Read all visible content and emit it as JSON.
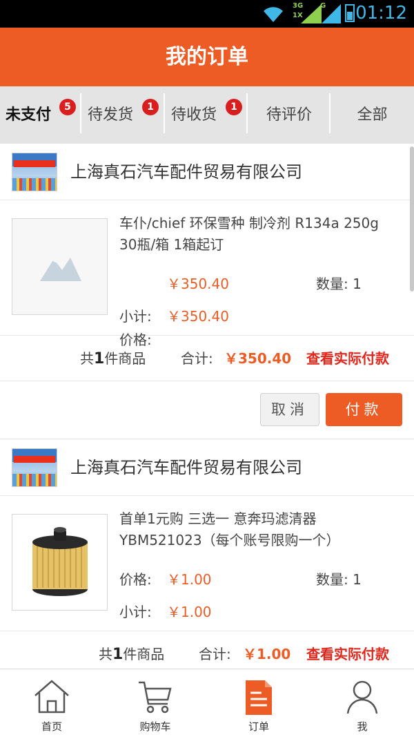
{
  "status_bar": {
    "time": "01:12",
    "net1_top": "3G",
    "net1_bottom": "1X",
    "net2": "G"
  },
  "header": {
    "title": "我的订单"
  },
  "tabs": [
    {
      "label": "未支付",
      "badge": "5",
      "active": true
    },
    {
      "label": "待发货",
      "badge": "1",
      "active": false
    },
    {
      "label": "待收货",
      "badge": "1",
      "active": false
    },
    {
      "label": "待评价",
      "badge": "",
      "active": false
    },
    {
      "label": "全部",
      "badge": "",
      "active": false
    }
  ],
  "orders": [
    {
      "shop_name": "上海真石汽车配件贸易有限公司",
      "product_name": "车仆/chief 环保雪种 制冷剂 R134a 250g 30瓶/箱 1箱起订",
      "price_label": "价格:",
      "price": "￥350.40",
      "qty_label": "数量:",
      "qty": "1",
      "subtotal_label": "小计:",
      "subtotal": "￥350.40",
      "count_prefix": "共",
      "count": "1",
      "count_suffix": "件商品",
      "total_label": "合计:",
      "total": "￥350.40",
      "view_payment": "查看实际付款",
      "cancel_label": "取消",
      "pay_label": "付款",
      "thumb": "placeholder-image-icon"
    },
    {
      "shop_name": "上海真石汽车配件贸易有限公司",
      "product_name": "首单1元购 三选一 意奔玛滤清器 YBM521023（每个账号限购一个）",
      "price_label": "价格:",
      "price": "￥1.00",
      "qty_label": "数量:",
      "qty": "1",
      "subtotal_label": "小计:",
      "subtotal": "￥1.00",
      "count_prefix": "共",
      "count": "1",
      "count_suffix": "件商品",
      "total_label": "合计:",
      "total": "￥1.00",
      "view_payment": "查看实际付款",
      "thumb": "oil-filter-image"
    }
  ],
  "bottom_nav": [
    {
      "label": "首页",
      "icon": "home-icon",
      "active": false
    },
    {
      "label": "购物车",
      "icon": "cart-icon",
      "active": false
    },
    {
      "label": "订单",
      "icon": "order-icon",
      "active": true
    },
    {
      "label": "我",
      "icon": "user-icon",
      "active": false
    }
  ],
  "colors": {
    "accent": "#ec5c24",
    "badge": "#d91e1e",
    "link": "#e2261b",
    "status_text": "#3fb8e8"
  }
}
